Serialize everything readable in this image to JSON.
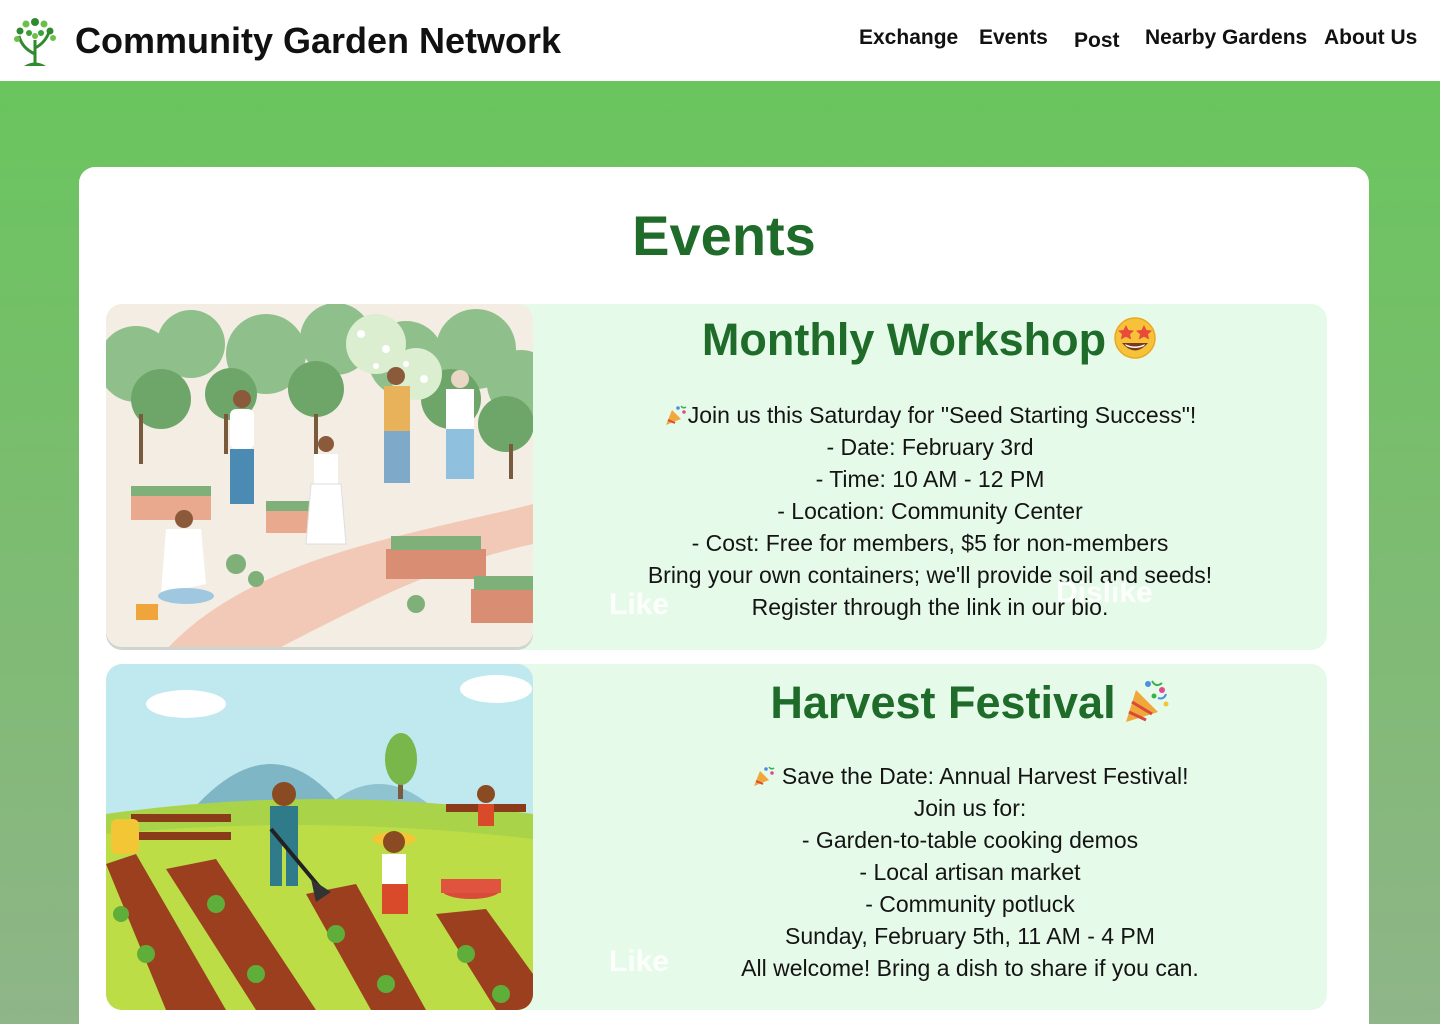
{
  "header": {
    "brand_title": "Community Garden Network",
    "nav": [
      "Exchange",
      "Events",
      "Post",
      "Nearby Gardens",
      "About Us"
    ]
  },
  "page": {
    "title": "Events"
  },
  "events": [
    {
      "title": "Monthly Workshop",
      "title_emoji": "star-struck-emoji",
      "lines": [
        "Join us this Saturday for \"Seed Starting Success\"!",
        "- Date: February 3rd",
        "- Time: 10 AM - 12 PM",
        "- Location: Community Center",
        "- Cost: Free for members, $5 for non-members",
        "Bring your own containers; we'll provide soil and seeds!",
        "Register through the link in our bio."
      ],
      "like_label": "Like",
      "dislike_label": "Dislike",
      "image": "community-garden-illustration"
    },
    {
      "title": "Harvest Festival",
      "title_emoji": "party-popper-emoji",
      "lines": [
        "Save the Date: Annual Harvest Festival!",
        "Join us for:",
        "- Garden-to-table cooking demos",
        "- Local artisan market",
        "- Community potluck",
        "Sunday, February 5th, 11 AM - 4 PM",
        "All welcome! Bring a dish to share if you can."
      ],
      "like_label": "Like",
      "image": "children-farming-illustration"
    }
  ],
  "colors": {
    "accent_green": "#1f6b2a",
    "card_bg": "#e6fae9",
    "page_gradient_top": "#66c75a",
    "page_gradient_bottom": "#8fb588"
  }
}
